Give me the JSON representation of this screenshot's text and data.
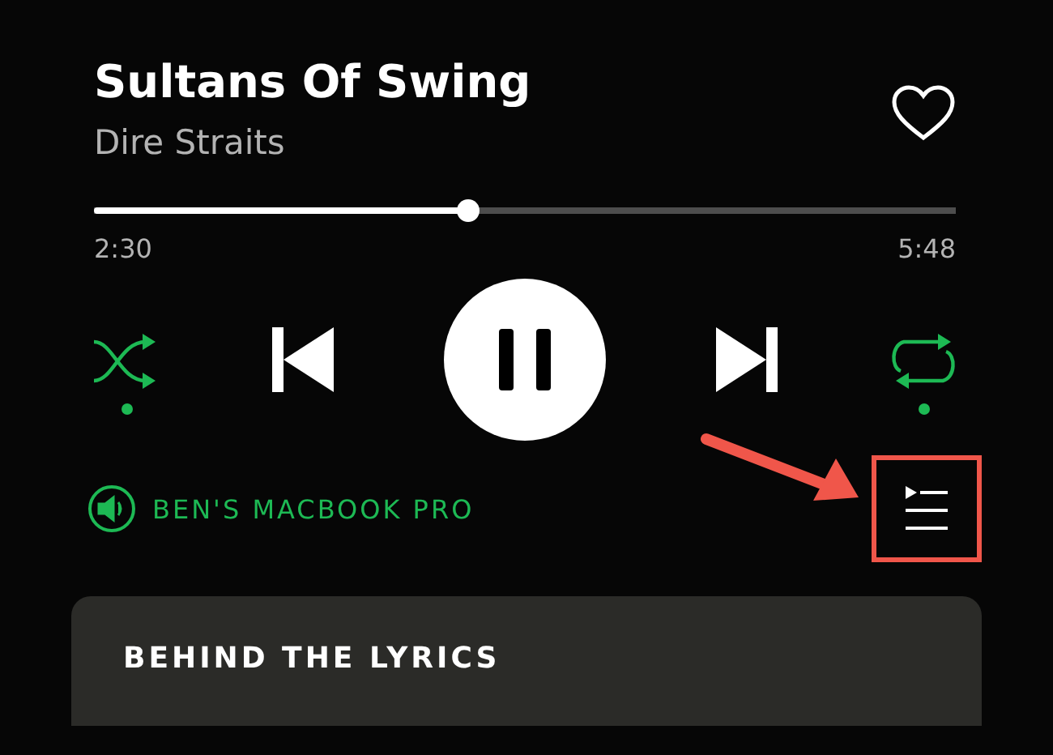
{
  "track": {
    "title": "Sultans Of Swing",
    "artist": "Dire Straits",
    "liked": false
  },
  "progress": {
    "level": 0.434,
    "elapsed": "2:30",
    "duration": "5:48"
  },
  "controls": {
    "shuffle": true,
    "repeat": true,
    "playing": true
  },
  "device": {
    "name": "BEN'S MACBOOK PRO"
  },
  "card": {
    "title": "BEHIND THE LYRICS"
  }
}
